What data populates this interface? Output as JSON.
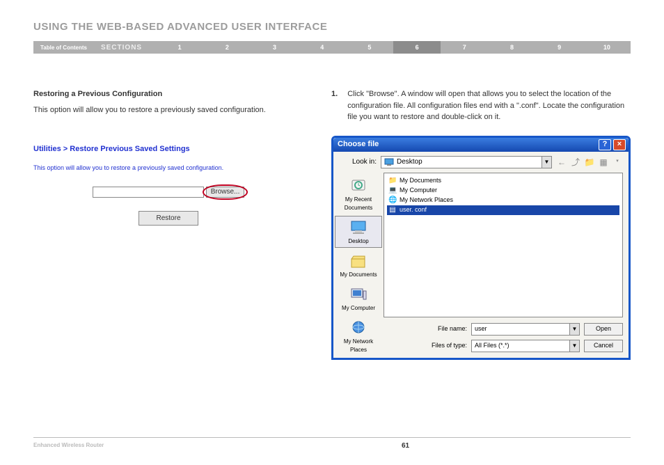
{
  "page": {
    "title": "USING THE WEB-BASED ADVANCED USER INTERFACE",
    "footer_product": "Enhanced Wireless Router",
    "footer_page": "61"
  },
  "nav": {
    "toc": "Table of Contents",
    "sections_label": "SECTIONS",
    "items": [
      "1",
      "2",
      "3",
      "4",
      "5",
      "6",
      "7",
      "8",
      "9",
      "10"
    ],
    "active_index": 5
  },
  "left": {
    "subheading": "Restoring a Previous Configuration",
    "body": "This option will allow you to restore a previously saved configuration.",
    "panel": {
      "title": "Utilities > Restore Previous Saved Settings",
      "desc": "This option will allow you to restore a previously saved configuration.",
      "browse_label": "Browse...",
      "restore_label": "Restore"
    }
  },
  "right": {
    "step_num": "1.",
    "step_text": "Click \"Browse\". A window will open that allows you to select the location of the configuration file. All configuration files end with a \".conf\". Locate the configuration file you want to restore and double-click on it."
  },
  "dialog": {
    "title": "Choose file",
    "lookin_label": "Look in:",
    "lookin_value": "Desktop",
    "toolicons": [
      "←",
      "📁",
      "⤴",
      "▦",
      "▾"
    ],
    "sidebar": [
      {
        "label": "My Recent Documents",
        "icon": "recent"
      },
      {
        "label": "Desktop",
        "icon": "desktop",
        "selected": true
      },
      {
        "label": "My Documents",
        "icon": "docs"
      },
      {
        "label": "My Computer",
        "icon": "computer"
      },
      {
        "label": "My Network Places",
        "icon": "network"
      }
    ],
    "listing": [
      {
        "name": "My Documents",
        "icon": "folder"
      },
      {
        "name": "My Computer",
        "icon": "computer"
      },
      {
        "name": "My Network Places",
        "icon": "network"
      },
      {
        "name": "user. conf",
        "icon": "file",
        "selected": true
      }
    ],
    "filename_label": "File name:",
    "filename_value": "user",
    "filetype_label": "Files of type:",
    "filetype_value": "All Files (*.*)",
    "open_label": "Open",
    "cancel_label": "Cancel"
  }
}
